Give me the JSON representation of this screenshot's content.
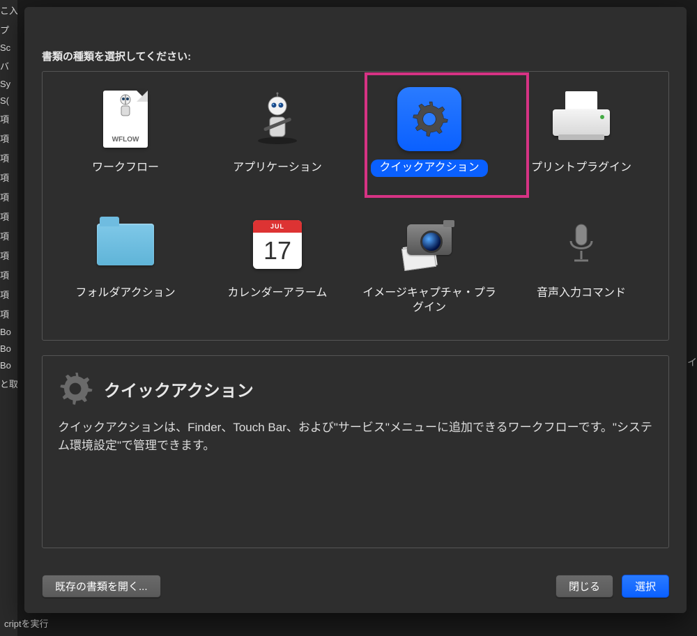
{
  "prompt": "書類の種類を選択してください:",
  "items": [
    {
      "key": "workflow",
      "label": "ワークフロー",
      "doclabel": "WFLOW"
    },
    {
      "key": "application",
      "label": "アプリケーション"
    },
    {
      "key": "quick-action",
      "label": "クイックアクション",
      "selected": true
    },
    {
      "key": "print-plugin",
      "label": "プリントプラグイン"
    },
    {
      "key": "folder-action",
      "label": "フォルダアクション"
    },
    {
      "key": "calendar-alarm",
      "label": "カレンダーアラーム",
      "cal_month": "JUL",
      "cal_day": "17"
    },
    {
      "key": "image-capture-plugin",
      "label": "イメージキャプチャ・プラグイン"
    },
    {
      "key": "dictation-command",
      "label": "音声入力コマンド"
    }
  ],
  "description": {
    "title": "クイックアクション",
    "body": "クイックアクションは、Finder、Touch Bar、および\"サービス\"メニューに追加できるワークフローです。\"システム環境設定\"で管理できます。"
  },
  "buttons": {
    "open_existing": "既存の書類を開く...",
    "close": "閉じる",
    "choose": "選択"
  },
  "sidebar_fragments": [
    "こ入",
    "プ",
    "Sc",
    "バ",
    "Sy",
    "S(",
    "項",
    "項",
    "項",
    "項",
    "項",
    "項",
    "項",
    "項",
    "項",
    "項",
    "項",
    "Bo",
    "Bo",
    "Bo",
    "と取"
  ],
  "status_bar": "criptを実行",
  "right_hint": "イ"
}
